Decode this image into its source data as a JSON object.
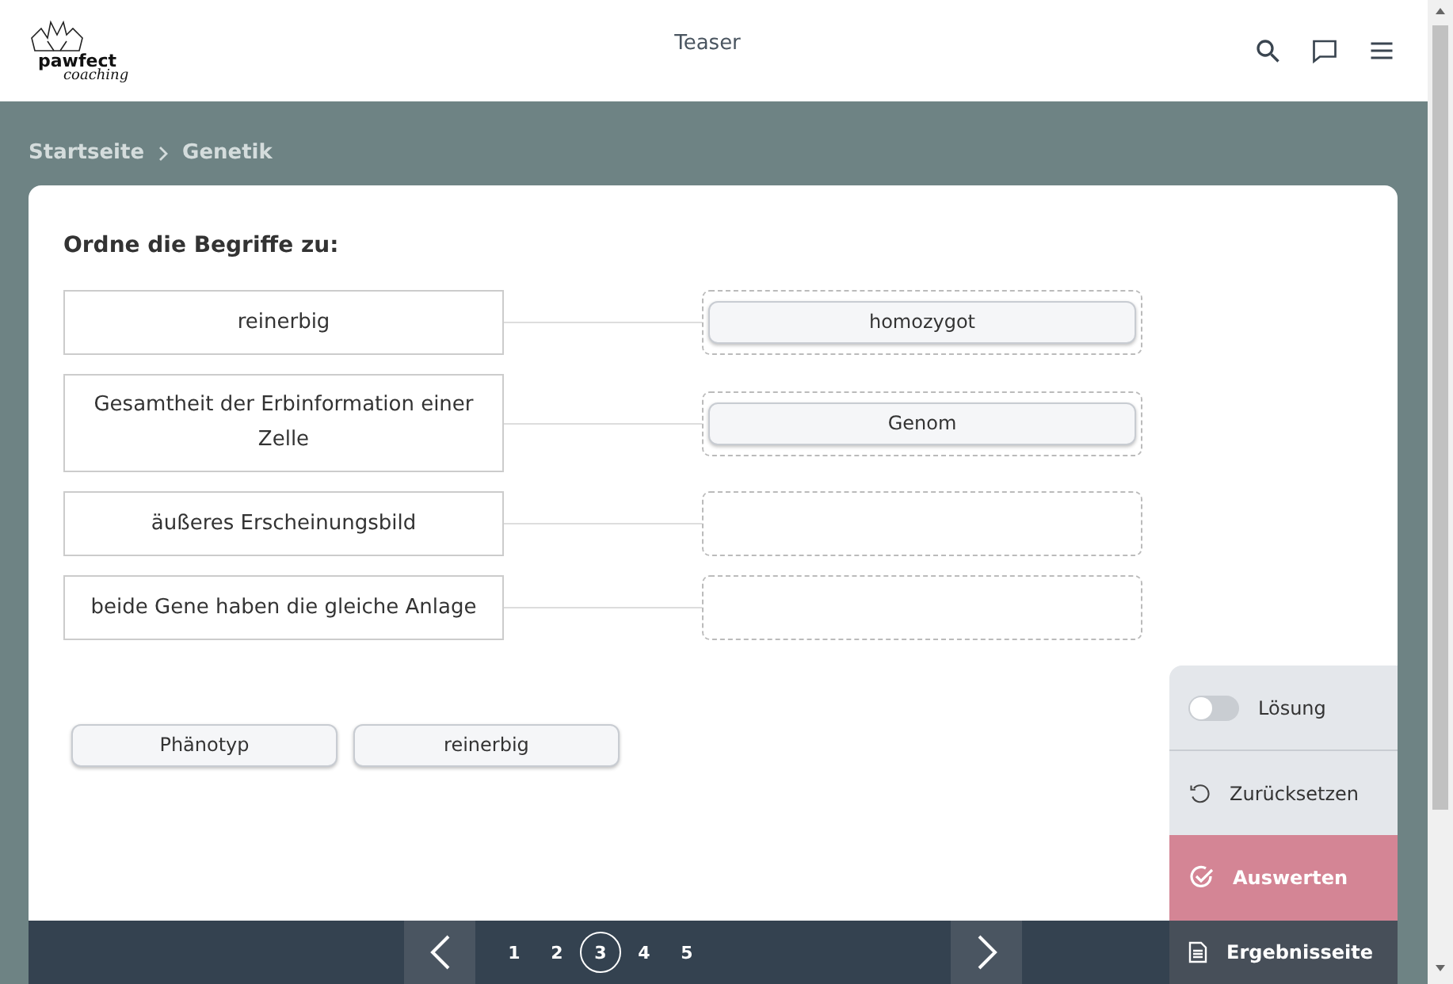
{
  "header": {
    "logo": {
      "name": "pawfect",
      "sub": "coaching"
    },
    "title": "Teaser"
  },
  "breadcrumb": [
    "Startseite",
    "Genetik"
  ],
  "task": {
    "prompt": "Ordne die Begriffe zu:",
    "pairs": [
      {
        "term": "reinerbig",
        "answer": "homozygot"
      },
      {
        "term": "Gesamtheit der Erbinformation einer Zelle",
        "answer": "Genom"
      },
      {
        "term": "äußeres Erscheinungsbild"
      },
      {
        "term": "beide Gene haben die gleiche Anlage"
      }
    ],
    "pool": [
      "Phänotyp",
      "reinerbig"
    ]
  },
  "side_panel": {
    "solution": {
      "label": "Lösung",
      "on": false
    },
    "reset": "Zurücksetzen",
    "evaluate": "Auswerten",
    "results": "Ergebnisseite"
  },
  "pagination": {
    "pages": [
      {
        "label": "1",
        "selected": false
      },
      {
        "label": "2",
        "selected": false
      },
      {
        "label": "3",
        "selected": true
      },
      {
        "label": "4",
        "selected": false
      },
      {
        "label": "5",
        "selected": false
      }
    ]
  }
}
